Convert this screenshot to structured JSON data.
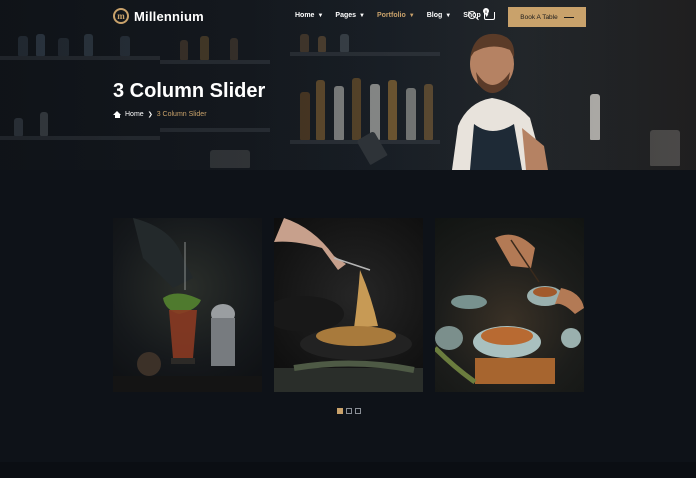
{
  "header": {
    "logo_text": "Millennium",
    "logo_icon": "m-monogram-icon",
    "nav": [
      {
        "label": "Home",
        "active": false
      },
      {
        "label": "Pages",
        "active": false
      },
      {
        "label": "Portfolio",
        "active": true
      },
      {
        "label": "Blog",
        "active": false
      },
      {
        "label": "Shop",
        "active": false
      }
    ],
    "cart_count": "0",
    "book_button": "Book A Table"
  },
  "hero": {
    "title": "3 Column Slider",
    "breadcrumb_home": "Home",
    "breadcrumb_current": "3 Column Slider"
  },
  "slider": {
    "slides": [
      "cocktail-image",
      "pasta-image",
      "food-bowl-image"
    ],
    "dots": [
      true,
      false,
      false
    ]
  },
  "colors": {
    "accent": "#c9a26b",
    "background": "#0e1218"
  }
}
